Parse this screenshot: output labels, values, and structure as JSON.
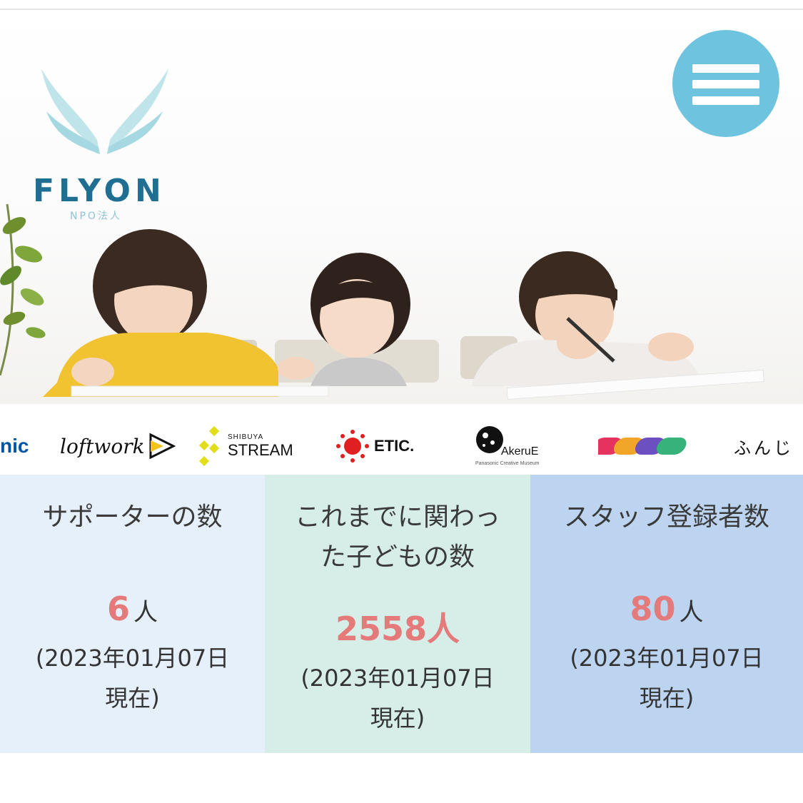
{
  "header": {
    "logo_word": "FLYON",
    "logo_sub": "NPO法人",
    "menu_icon": "hamburger-menu-icon"
  },
  "sponsors": [
    {
      "label": "nic",
      "color": "#0055a5"
    },
    {
      "label": "loftwork",
      "color": "#111111"
    },
    {
      "label_top": "SHIBUYA",
      "label": "STREAM",
      "color": "#e8e41a"
    },
    {
      "label": "ETIC.",
      "color": "#e02020"
    },
    {
      "label": "AkeruE",
      "sub": "Panasonic Creative Museum",
      "color": "#111111"
    },
    {
      "label": "",
      "color": "#e5335f"
    },
    {
      "label": "ふんじ",
      "color": "#111111"
    }
  ],
  "stats": [
    {
      "title": "サポーターの数",
      "number": "6",
      "unit": "人",
      "date_line1": "(2023年01月07日",
      "date_line2": "現在)",
      "bg": "#e6f0fb"
    },
    {
      "title_line1": "これまでに関わっ",
      "title_line2": "た子どもの数",
      "number": "2558",
      "unit": "人",
      "date_line1": "(2023年01月07日",
      "date_line2": "現在)",
      "bg": "#d6ede8"
    },
    {
      "title": "スタッフ登録者数",
      "number": "80",
      "unit": "人",
      "date_line1": "(2023年01月07日",
      "date_line2": "現在)",
      "bg": "#bcd4f0"
    }
  ],
  "colors": {
    "accent": "#6ec3de",
    "number": "#e57a7a",
    "logo": "#1f6f93"
  }
}
